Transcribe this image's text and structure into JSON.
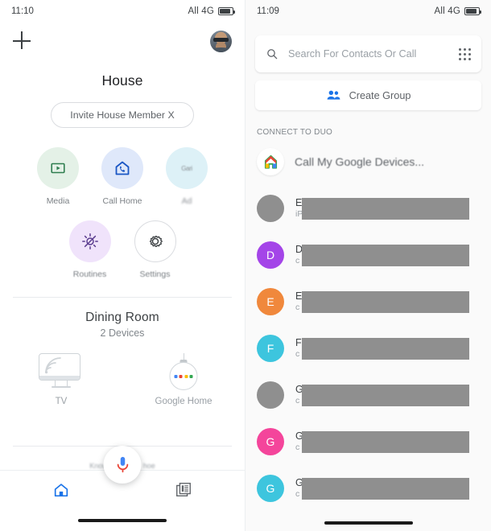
{
  "left": {
    "status": {
      "time": "11:10",
      "network": "All 4G",
      "battery_icon": "battery-icon"
    },
    "topbar": {
      "add_icon": "plus-icon",
      "avatar": "user-avatar"
    },
    "title": "House",
    "invite_button": "Invite House Member X",
    "quick_actions": [
      {
        "label": "Media",
        "icon": "media-play-icon"
      },
      {
        "label": "Call Home",
        "icon": "call-home-icon"
      },
      {
        "label": "Ad",
        "icon": "blurred-icon",
        "icon_text": "Gari"
      }
    ],
    "quick_actions_row2": [
      {
        "label": "Routines",
        "icon": "routine-brightness-icon"
      },
      {
        "label": "Settings",
        "icon": "gear-icon"
      }
    ],
    "room": {
      "name": "Dining Room",
      "devices_count": "2 Devices"
    },
    "devices": [
      {
        "label": "TV",
        "icon": "tv-cast-icon"
      },
      {
        "label": "Google Home",
        "icon": "google-home-speaker-icon"
      }
    ],
    "assistant_hints": {
      "left": "Know",
      "right": "hoe"
    },
    "mic_button": "mic-icon",
    "nav": [
      {
        "name": "home",
        "icon": "home-icon",
        "active": true
      },
      {
        "name": "feed",
        "icon": "feed-icon",
        "active": false
      }
    ]
  },
  "right": {
    "status": {
      "time": "11:09",
      "network": "All 4G",
      "battery_icon": "battery-icon"
    },
    "search": {
      "placeholder": "Search For Contacts Or Call",
      "icon": "search-icon",
      "keypad_icon": "keypad-icon"
    },
    "create_group": {
      "label": "Create Group",
      "icon": "group-people-icon"
    },
    "section_header": "CONNECT TO DUO",
    "duo_device": {
      "label": "Call My Google Devices...",
      "icon": "google-home-logo"
    },
    "contacts": [
      {
        "initial": "",
        "color": "#8f8f8f",
        "name": "E",
        "sub": "iP"
      },
      {
        "initial": "D",
        "color": "#a445e8",
        "name": "D",
        "sub": "c"
      },
      {
        "initial": "E",
        "color": "#f0883c",
        "name": "E",
        "sub": "c"
      },
      {
        "initial": "F",
        "color": "#3dc5de",
        "name": "F",
        "sub": "c"
      },
      {
        "initial": "",
        "color": "#8f8f8f",
        "name": "G",
        "sub": "c"
      },
      {
        "initial": "G",
        "color": "#f4459b",
        "name": "G",
        "sub": "c"
      },
      {
        "initial": "G",
        "color": "#3dc5de",
        "name": "G",
        "sub": "c"
      }
    ]
  },
  "colors": {
    "accent_blue": "#1a73e8",
    "google_red": "#ea4335",
    "google_yellow": "#fbbc04",
    "google_green": "#34a853"
  }
}
